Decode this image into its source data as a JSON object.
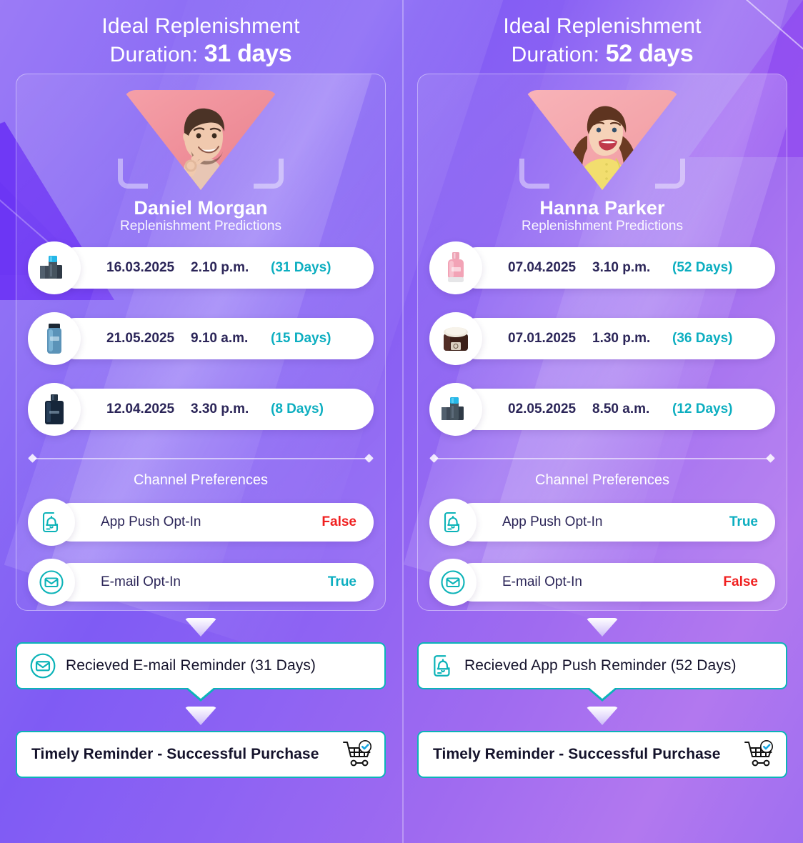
{
  "theme": {
    "accent_teal": "#0cb3b8",
    "accent_red": "#f01f1f",
    "bg_purple": "#7b4dfa",
    "text_dark": "#2b2558"
  },
  "columns": [
    {
      "header": {
        "line1": "Ideal Replenishment",
        "line2_prefix": "Duration: ",
        "line2_value": "31 days"
      },
      "profile": {
        "name": "Daniel Morgan",
        "subtitle": "Replenishment Predictions",
        "avatar_icon": "avatar-photo-man-ok-gesture"
      },
      "predictions": [
        {
          "product_icon": "product-deodorant-set-dark",
          "date": "16.03.2025",
          "time": "2.10 p.m.",
          "days": "(31 Days)"
        },
        {
          "product_icon": "product-mens-bottle-blue",
          "date": "21.05.2025",
          "time": "9.10 a.m.",
          "days": "(15 Days)"
        },
        {
          "product_icon": "product-brand-perfume-navy",
          "date": "12.04.2025",
          "time": "3.30 p.m.",
          "days": "(8 Days)"
        }
      ],
      "preferences_title": "Channel Preferences",
      "preferences": [
        {
          "icon": "app-push-bell-icon",
          "label": "App Push Opt-In",
          "value": "False",
          "state": "false"
        },
        {
          "icon": "email-envelope-icon",
          "label": "E-mail Opt-In",
          "value": "True",
          "state": "true"
        }
      ],
      "flow": {
        "reminder_icon": "email-envelope-icon",
        "reminder_text": "Recieved E-mail Reminder (31 Days)",
        "purchase_text": "Timely Reminder - Successful Purchase",
        "purchase_icon": "cart-check-icon"
      }
    },
    {
      "header": {
        "line1": "Ideal Replenishment",
        "line2_prefix": "Duration: ",
        "line2_value": "52 days"
      },
      "profile": {
        "name": "Hanna Parker",
        "subtitle": "Replenishment Predictions",
        "avatar_icon": "avatar-photo-woman-laughing"
      },
      "predictions": [
        {
          "product_icon": "product-pink-perfume",
          "date": "07.04.2025",
          "time": "3.10 p.m.",
          "days": "(52 Days)"
        },
        {
          "product_icon": "product-cream-jar-brown",
          "date": "07.01.2025",
          "time": "1.30 p.m.",
          "days": "(36 Days)"
        },
        {
          "product_icon": "product-deodorant-set-dark",
          "date": "02.05.2025",
          "time": "8.50 a.m.",
          "days": "(12 Days)"
        }
      ],
      "preferences_title": "Channel Preferences",
      "preferences": [
        {
          "icon": "app-push-bell-icon",
          "label": "App Push Opt-In",
          "value": "True",
          "state": "true"
        },
        {
          "icon": "email-envelope-icon",
          "label": "E-mail Opt-In",
          "value": "False",
          "state": "false"
        }
      ],
      "flow": {
        "reminder_icon": "app-push-bell-icon",
        "reminder_text": "Recieved App Push Reminder (52 Days)",
        "purchase_text": "Timely Reminder - Successful Purchase",
        "purchase_icon": "cart-check-icon"
      }
    }
  ]
}
